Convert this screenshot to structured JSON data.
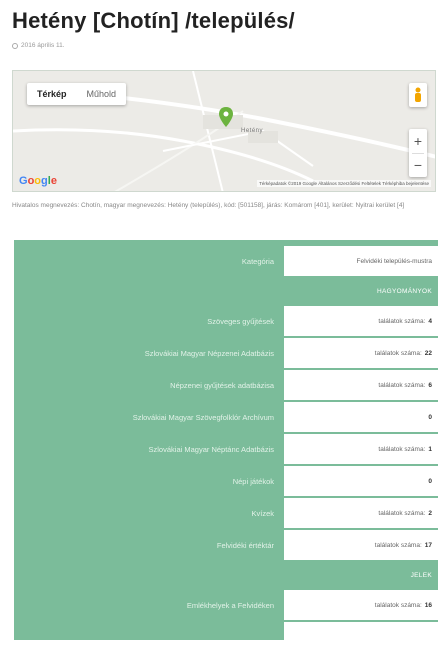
{
  "page": {
    "title": "Hetény [Chotín] /település/",
    "date": "2016 április 11."
  },
  "map": {
    "tabs": [
      "Térkép",
      "Műhold"
    ],
    "town_label": "Hetény",
    "logo": "Google",
    "footer": "Térképadatok ©2019 Google   Általános Szerződési Feltételek   Térképhiba bejelentése",
    "zoom_in": "+",
    "zoom_out": "−",
    "icons": [
      "pegman-icon",
      "map-pin-icon"
    ]
  },
  "description": "Hivatalos megnevezés: Chotín, magyar megnevezés: Hetény (település), kód: [501158], járás: Komárom [401], kerület: Nyitrai kerület [4]",
  "table": {
    "category": {
      "label": "Kategória",
      "value": "Felvidéki település-mustra"
    },
    "sections": [
      {
        "header": "HAGYOMÁNYOK",
        "rows": [
          {
            "label": "Szöveges gyűjtések",
            "prefix": "találatok száma:",
            "count": "4"
          },
          {
            "label": "Szlovákiai Magyar Népzenei Adatbázis",
            "prefix": "találatok száma:",
            "count": "22"
          },
          {
            "label": "Népzenei gyűjtések adatbázisa",
            "prefix": "találatok száma:",
            "count": "6"
          },
          {
            "label": "Szlovákiai Magyar Szövegfolklór Archívum",
            "prefix": "",
            "count": "0"
          },
          {
            "label": "Szlovákiai Magyar Néptánc Adatbázis",
            "prefix": "találatok száma:",
            "count": "1"
          },
          {
            "label": "Népi játékok",
            "prefix": "",
            "count": "0"
          },
          {
            "label": "Kvízek",
            "prefix": "találatok száma:",
            "count": "2"
          },
          {
            "label": "Felvidéki értéktár",
            "prefix": "találatok száma:",
            "count": "17"
          }
        ]
      },
      {
        "header": "JELEK",
        "rows": [
          {
            "label": "Emlékhelyek a Felvidéken",
            "prefix": "találatok száma:",
            "count": "16"
          }
        ]
      }
    ]
  },
  "colors": {
    "table_green": "#7bbc9a",
    "pin_green": "#6cb33f"
  }
}
